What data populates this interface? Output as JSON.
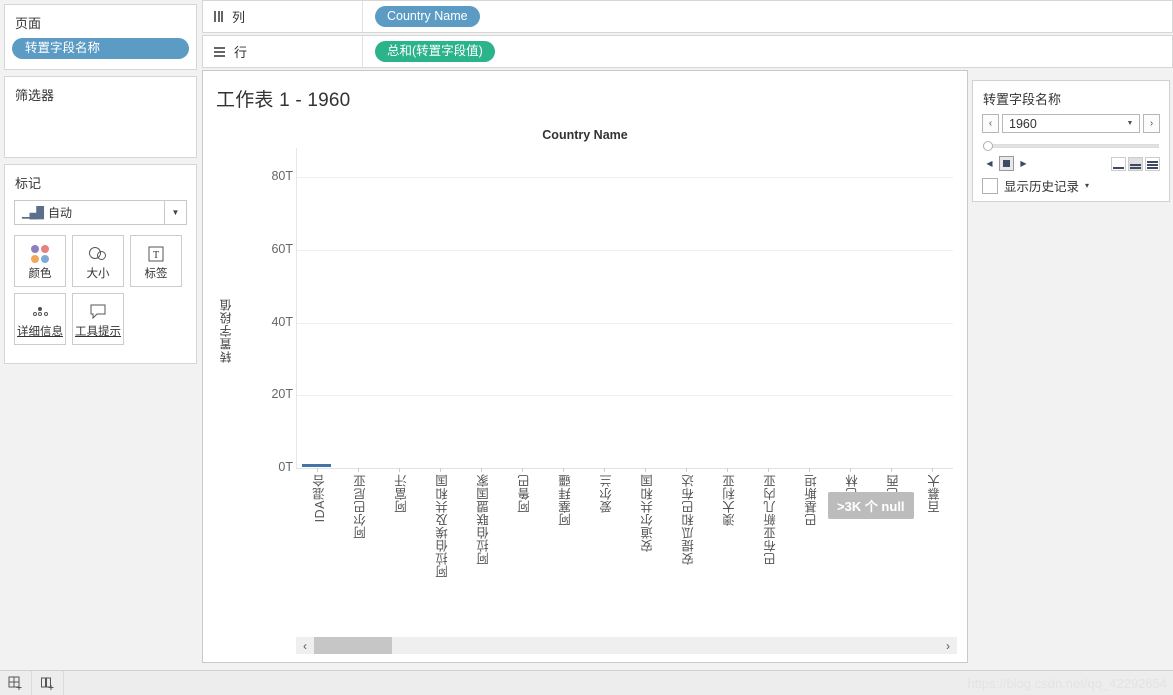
{
  "sidebar": {
    "pages": {
      "title": "页面",
      "pill": "转置字段名称"
    },
    "filters": {
      "title": "筛选器"
    },
    "marks": {
      "title": "标记",
      "mark_type": "自动",
      "mark_type_icon": "bar-chart-icon",
      "buttons": [
        {
          "label": "颜色",
          "icon": "color-dots-icon"
        },
        {
          "label": "大小",
          "icon": "size-circles-icon"
        },
        {
          "label": "标签",
          "icon": "label-text-icon"
        },
        {
          "label": "详细信息",
          "icon": "detail-dots-icon"
        },
        {
          "label": "工具提示",
          "icon": "tooltip-bubble-icon"
        }
      ]
    }
  },
  "shelves": [
    {
      "label": "列",
      "icon": "columns-icon",
      "pills": [
        {
          "text": "Country Name",
          "color": "#5b9bc4"
        }
      ]
    },
    {
      "label": "行",
      "icon": "rows-icon",
      "pills": [
        {
          "text": "总和(转置字段值)",
          "color": "#2bb38a"
        }
      ]
    }
  ],
  "viz": {
    "title": "工作表 1 - 1960",
    "column_header": "Country Name",
    "null_badge": ">3K 个 null",
    "scrollbar": {
      "left_arrow": "‹",
      "right_arrow": "›"
    }
  },
  "right_panel": {
    "title": "转置字段名称",
    "prev_label": "‹",
    "next_label": "›",
    "selected_value": "1960",
    "dropdown_arrow": "▼",
    "playback": {
      "back_label": "◀",
      "stop_label": "■",
      "forward_label": "▶",
      "speeds": [
        "slow-speed-icon",
        "medium-speed-icon",
        "fast-speed-icon"
      ],
      "selected_speed": 1
    },
    "history": {
      "label": "显示历史记录",
      "arrow": "▾",
      "checked": false
    }
  },
  "bottom_bar": {
    "buttons": [
      {
        "icon": "new-worksheet-icon"
      },
      {
        "icon": "new-dashboard-icon"
      }
    ],
    "watermark": "https://blog.csdn.net/qq_42292654"
  },
  "chart_data": {
    "type": "bar",
    "title": "工作表 1 - 1960",
    "xlabel": "Country Name",
    "ylabel": "转置字段值",
    "ytick_labels": [
      "80T",
      "60T",
      "40T",
      "20T",
      "0T"
    ],
    "ytick_values": [
      80,
      60,
      40,
      20,
      0
    ],
    "ylim": [
      0,
      88
    ],
    "yunit": "T",
    "grid": true,
    "legend": "none",
    "annotation": ">3K 个 null",
    "categories": [
      "IDA混合",
      "阿尔巴尼亚",
      "阿富汗",
      "阿拉伯埃及共和国",
      "阿拉伯联盟国家",
      "阿鲁巴",
      "阿塞拜疆",
      "爱尔兰",
      "安道尔共和国",
      "安提瓜和巴布达",
      "澳大利亚",
      "巴布亚新几内亚",
      "巴基斯坦",
      "巴林",
      "巴西",
      "百慕大"
    ],
    "values": [
      0.4,
      0,
      0,
      0,
      0,
      0,
      0,
      0,
      0,
      0,
      0,
      0,
      0,
      0,
      0,
      0
    ]
  }
}
